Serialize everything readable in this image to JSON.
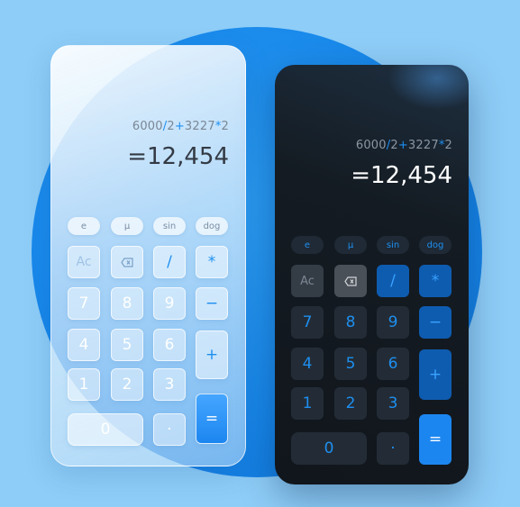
{
  "light": {
    "expression": {
      "a": "6000",
      "op1": "/",
      "b": "2",
      "op2": "+",
      "c": "3227",
      "op3": "*",
      "d": "2"
    },
    "result": "=12,454",
    "sci_keys": [
      "e",
      "μ",
      "sin",
      "dog"
    ],
    "keys": {
      "ac": "Ac",
      "del": "⌫",
      "div": "/",
      "mul": "*",
      "n7": "7",
      "n8": "8",
      "n9": "9",
      "minus": "−",
      "n4": "4",
      "n5": "5",
      "n6": "6",
      "plus": "+",
      "n1": "1",
      "n2": "2",
      "n3": "3",
      "n0": "0",
      "dot": "·",
      "eq": "="
    }
  },
  "dark": {
    "expression": {
      "a": "6000",
      "op1": "/",
      "b": "2",
      "op2": "+",
      "c": "3227",
      "op3": "*",
      "d": "2"
    },
    "result": "=12,454",
    "sci_keys": [
      "e",
      "μ",
      "sin",
      "dog"
    ],
    "keys": {
      "ac": "Ac",
      "del": "⌫",
      "div": "/",
      "mul": "*",
      "n7": "7",
      "n8": "8",
      "n9": "9",
      "minus": "−",
      "n4": "4",
      "n5": "5",
      "n6": "6",
      "plus": "+",
      "n1": "1",
      "n2": "2",
      "n3": "3",
      "n0": "0",
      "dot": "·",
      "eq": "="
    }
  },
  "colors": {
    "background": "#8ecdf7",
    "circle": "#1787ea",
    "accent": "#1e8ff0",
    "dark_panel": "#11161c"
  }
}
